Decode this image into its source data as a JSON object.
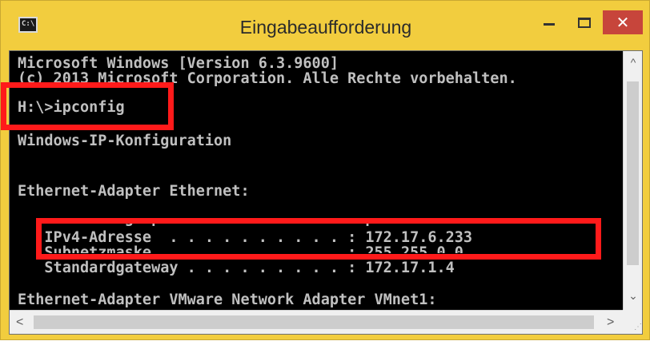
{
  "window": {
    "title": "Eingabeaufforderung",
    "icon_label": "C:\\.",
    "close_glyph": "✕"
  },
  "console": {
    "lines": [
      "Microsoft Windows [Version 6.3.9600]",
      "(c) 2013 Microsoft Corporation. Alle Rechte vorbehalten.",
      "H:\\>ipconfig",
      "Windows-IP-Konfiguration",
      "Ethernet-Adapter Ethernet:",
      "   Verbindungsspezifisches DNS-Suffix: pt.local",
      "   IPv4-Adresse  . . . . . . . . . . : 172.17.6.233",
      "   Subnetzmaske  . . . . . . . . . . : 255.255.0.0",
      "   Standardgateway . . . . . . . . . : 172.17.1.4",
      "Ethernet-Adapter VMware Network Adapter VMnet1:"
    ]
  },
  "colors": {
    "titlebar": "#f2cd3e",
    "console_bg": "#000000",
    "console_text": "#c0c0c0",
    "highlight": "#ff1a1a",
    "close_button": "#c7453b"
  },
  "icons": {
    "minimize": "minimize-icon",
    "maximize": "maximize-icon",
    "close": "close-icon",
    "scroll_up": "chevron-up-icon",
    "scroll_down": "chevron-down-icon",
    "scroll_left": "chevron-left-icon",
    "scroll_right": "chevron-right-icon"
  }
}
